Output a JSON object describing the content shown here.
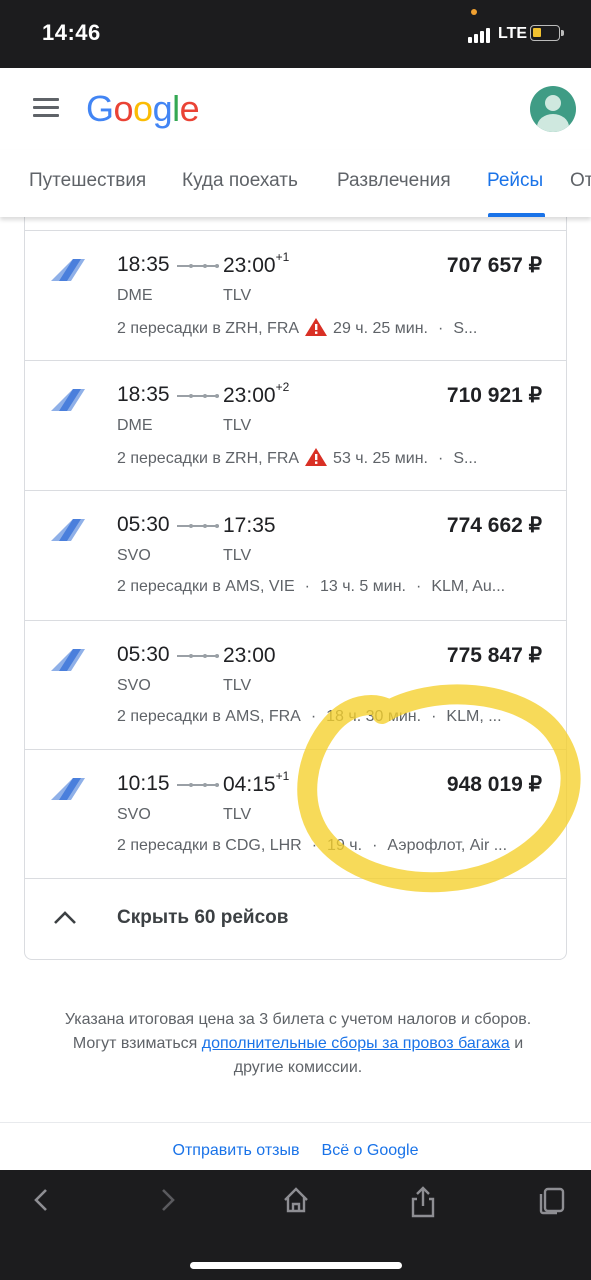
{
  "status_bar": {
    "time": "14:46",
    "network": "LTE"
  },
  "header": {
    "logo_letters": [
      "G",
      "o",
      "o",
      "g",
      "l",
      "e"
    ],
    "logo_colors": [
      "#4285F4",
      "#EA4335",
      "#FBBC05",
      "#4285F4",
      "#34A853",
      "#EA4335"
    ]
  },
  "tabs": [
    {
      "label": "Путешествия",
      "active": false
    },
    {
      "label": "Куда поехать",
      "active": false
    },
    {
      "label": "Развлечения",
      "active": false
    },
    {
      "label": "Рейсы",
      "active": true
    },
    {
      "label": "От",
      "active": false
    }
  ],
  "flights": [
    {
      "depart": "18:35",
      "arrive": "23:00",
      "day_offset": "+1",
      "from": "DME",
      "to": "TLV",
      "price": "707 657 ₽",
      "stops": "2 пересадки в ZRH, FRA",
      "warning": true,
      "duration": "29 ч. 25 мин.",
      "airline": "S..."
    },
    {
      "depart": "18:35",
      "arrive": "23:00",
      "day_offset": "+2",
      "from": "DME",
      "to": "TLV",
      "price": "710 921 ₽",
      "stops": "2 пересадки в ZRH, FRA",
      "warning": true,
      "duration": "53 ч. 25 мин.",
      "airline": "S..."
    },
    {
      "depart": "05:30",
      "arrive": "17:35",
      "day_offset": "",
      "from": "SVO",
      "to": "TLV",
      "price": "774 662 ₽",
      "stops": "2 пересадки в AMS, VIE",
      "warning": false,
      "duration": "13 ч. 5 мин.",
      "airline": "KLM, Au..."
    },
    {
      "depart": "05:30",
      "arrive": "23:00",
      "day_offset": "",
      "from": "SVO",
      "to": "TLV",
      "price": "775 847 ₽",
      "stops": "2 пересадки в AMS, FRA",
      "warning": false,
      "duration": "18 ч. 30 мин.",
      "airline": "KLM, ..."
    },
    {
      "depart": "10:15",
      "arrive": "04:15",
      "day_offset": "+1",
      "from": "SVO",
      "to": "TLV",
      "price": "948 019 ₽",
      "stops": "2 пересадки в CDG, LHR",
      "warning": false,
      "duration": "19 ч.",
      "airline": "Аэрофлот, Air ..."
    }
  ],
  "collapse_label": "Скрыть 60 рейсов",
  "footnote": {
    "text_before": "Указана итоговая цена за 3 билета с учетом налогов и сборов. Могут взиматься ",
    "link": "дополнительные сборы за провоз багажа",
    "text_after": " и другие комиссии."
  },
  "footer": {
    "feedback": "Отправить отзыв",
    "about": "Всё о Google"
  },
  "colors": {
    "accent": "#1a73e8",
    "warning": "#d93025",
    "highlight": "#f5d02a"
  }
}
